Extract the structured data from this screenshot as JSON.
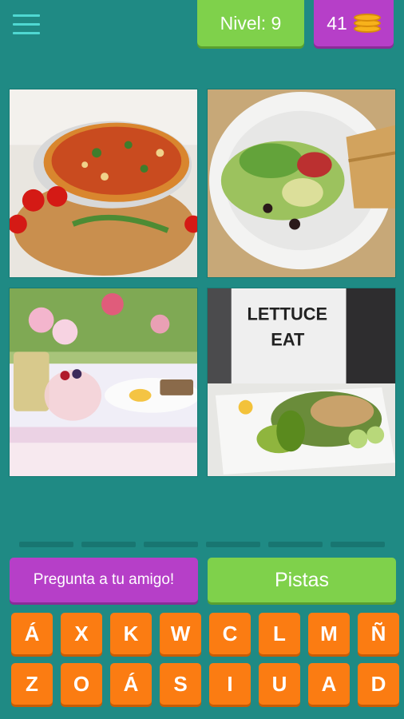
{
  "header": {
    "level_label": "Nivel: 9",
    "coins": "41",
    "coin_icon": "coins-icon",
    "menu_icon": "hamburger-menu-icon"
  },
  "images": [
    {
      "name": "pizza-image",
      "description": "pizza"
    },
    {
      "name": "salad-plate-image",
      "description": "salad plate with bread"
    },
    {
      "name": "breakfast-table-image",
      "description": "breakfast table"
    },
    {
      "name": "lettuce-shirt-salad-image",
      "description": "salad with shirt"
    }
  ],
  "answer": {
    "slot_count": 6
  },
  "actions": {
    "ask_friend": "Pregunta a tu amigo!",
    "hints": "Pistas"
  },
  "keyboard": {
    "row1": [
      "Á",
      "X",
      "K",
      "W",
      "C",
      "L",
      "M",
      "Ñ"
    ],
    "row2": [
      "Z",
      "O",
      "Á",
      "S",
      "I",
      "U",
      "A",
      "D"
    ]
  },
  "colors": {
    "background": "#1f8a84",
    "green": "#7fd14b",
    "purple": "#b63fc8",
    "orange": "#fb7c12"
  }
}
